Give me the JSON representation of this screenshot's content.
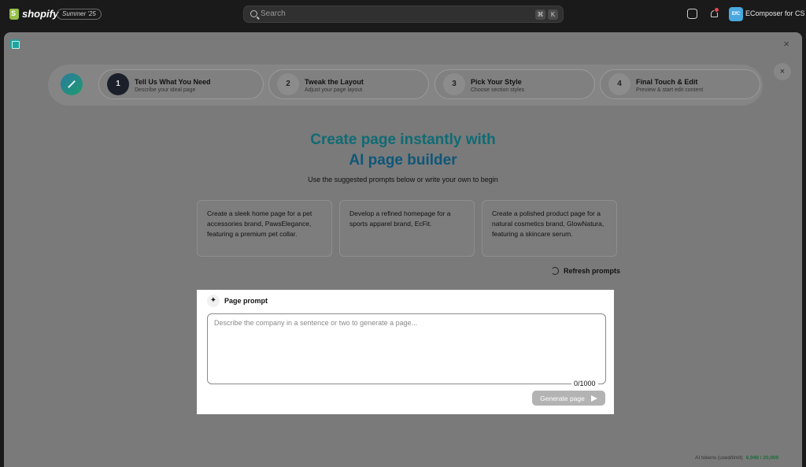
{
  "topbar": {
    "brand": "shopify",
    "edition": "Summer '25",
    "search_placeholder": "Search",
    "shortcut_cmd": "⌘",
    "shortcut_key": "K",
    "store_initials": "EfC",
    "store_name": "EComposer for CS"
  },
  "modal": {
    "close_label": "×",
    "close_round_label": "×"
  },
  "steps": [
    {
      "num": "1",
      "title": "Tell Us What You Need",
      "sub": "Describe your ideal page",
      "active": true
    },
    {
      "num": "2",
      "title": "Tweak the Layout",
      "sub": "Adjust your page layout",
      "active": false
    },
    {
      "num": "3",
      "title": "Pick Your Style",
      "sub": "Choose section styles",
      "active": false
    },
    {
      "num": "4",
      "title": "Final Touch & Edit",
      "sub": "Preview & start edit content",
      "active": false
    }
  ],
  "hero": {
    "line1": "Create page instantly with",
    "line2": "AI page builder",
    "subtitle": "Use the suggested prompts below or write your own to begin"
  },
  "prompts": [
    "Create a sleek home page for a pet accessories brand, PawsElegance, featuring a premium pet collar.",
    "Develop a refined homepage for a sports apparel brand, EcFit.",
    "Create a polished product page for a natural cosmetics brand, GlowNatura, featuring a skincare serum."
  ],
  "refresh_label": "Refresh prompts",
  "panel": {
    "icon": "sparkle-icon",
    "title": "Page prompt",
    "placeholder": "Describe the company in a sentence or two to generate a page...",
    "value": "",
    "counter": "0/1000",
    "generate_label": "Generate page"
  },
  "tokens": {
    "label": "AI tokens (used/limit)",
    "value": "6,948 / 20,000"
  }
}
